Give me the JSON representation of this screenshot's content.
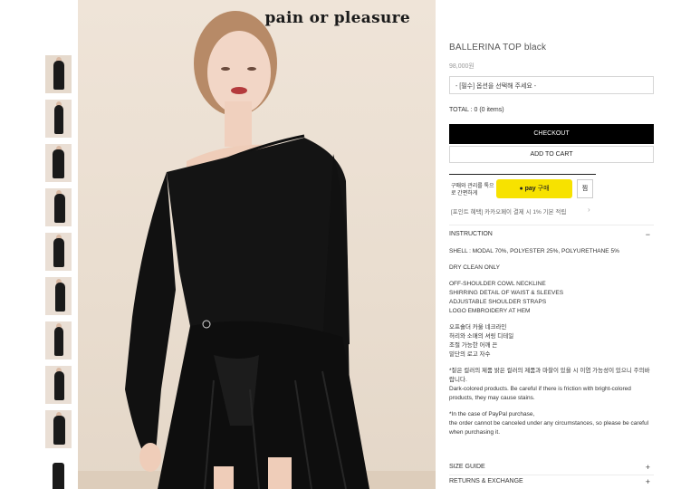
{
  "brand": {
    "logo_text": "pain or pleasure"
  },
  "product": {
    "title": "BALLERINA TOP black",
    "price": "98,000원",
    "option_select": "- [필수] 옵션을 선택해 주세요 -",
    "total": "TOTAL : 0 (0 items)",
    "checkout_label": "CHECKOUT",
    "add_to_cart_label": "ADD TO CART"
  },
  "kakao": {
    "note": "구매와 관리를 톡으로 간편하게",
    "pay_brand": "pay",
    "pay_action": "구매",
    "wish_label": "찜",
    "point_note": "[포인트 혜택] 카카오페이 결제 시 1% 기본 적립"
  },
  "sections": {
    "instruction": {
      "label": "INSTRUCTION",
      "sign": "−"
    },
    "size_guide": {
      "label": "SIZE GUIDE",
      "sign": "+"
    },
    "returns": {
      "label": "RETURNS & EXCHANGE",
      "sign": "+"
    }
  },
  "instruction": {
    "material": "SHELL : MODAL 70%, POLYESTER 25%, POLYURETHANE 5%",
    "care": "DRY CLEAN ONLY",
    "features_en": [
      "OFF-SHOULDER COWL NECKLINE",
      "SHIRRING DETAIL OF WAIST & SLEEVES",
      "ADJUSTABLE SHOULDER STRAPS",
      "LOGO EMBROIDERY AT HEM"
    ],
    "features_ko": [
      "오프숄더 카울 네크라인",
      "허리와 소매의 셔링 디테일",
      "조절 가능한 어깨 끈",
      "밑단의 로고 자수"
    ],
    "warning_ko": "*짙은 컬러의 제품 밝은 컬러의 제품과 마찰이 있을 시 이염 가능성이 있으니 주의바랍니다.",
    "warning_en": "Dark-colored products. Be careful if there is friction with bright-colored products, they may cause stains.",
    "paypal_1": "*In the case of PayPal purchase,",
    "paypal_2": "the order cannot be canceled under any circumstances, so please be careful when purchasing it."
  },
  "colors": {
    "accent_black": "#000000",
    "kakao_yellow": "#f7e200"
  }
}
